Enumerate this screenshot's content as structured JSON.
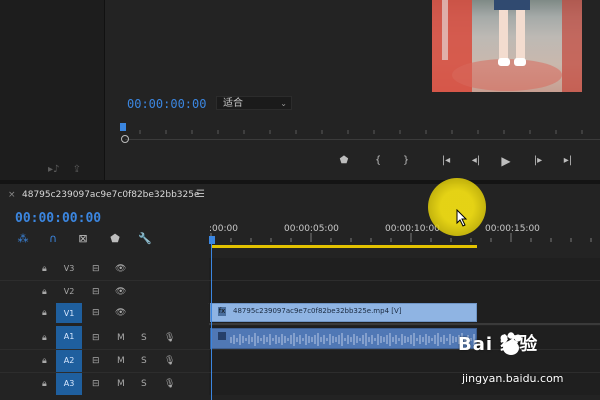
{
  "program_monitor": {
    "timecode": "00:00:00:00",
    "fit_select": "适合"
  },
  "sequence": {
    "tab_name": "48795c239097ac9e7c0f82be32bb325e",
    "timecode": "00:00:00:00"
  },
  "ruler": {
    "labels": [
      ":00:00",
      "00:00:05:00",
      "00:00:10:00",
      "00:00:15:00"
    ]
  },
  "tracks": [
    {
      "name": "V3",
      "type": "video",
      "active": false
    },
    {
      "name": "V2",
      "type": "video",
      "active": false
    },
    {
      "name": "V1",
      "type": "video",
      "active": true
    },
    {
      "name": "A1",
      "type": "audio",
      "active": true
    },
    {
      "name": "A2",
      "type": "audio",
      "active": true
    },
    {
      "name": "A3",
      "type": "audio",
      "active": true
    }
  ],
  "audio_controls": {
    "mute": "M",
    "solo": "S"
  },
  "clips": {
    "video": {
      "name": "48795c239097ac9e7c0f82be32bb325e.mp4 [V]"
    }
  },
  "watermark": {
    "main": "Bai 经验",
    "sub": "jingyan.baidu.com"
  },
  "colors": {
    "accent": "#3b86e0",
    "work_area": "#e3c200",
    "video_clip": "#8fb4e3",
    "audio_clip": "#5078b5",
    "cursor_highlight": "#efdc14"
  }
}
